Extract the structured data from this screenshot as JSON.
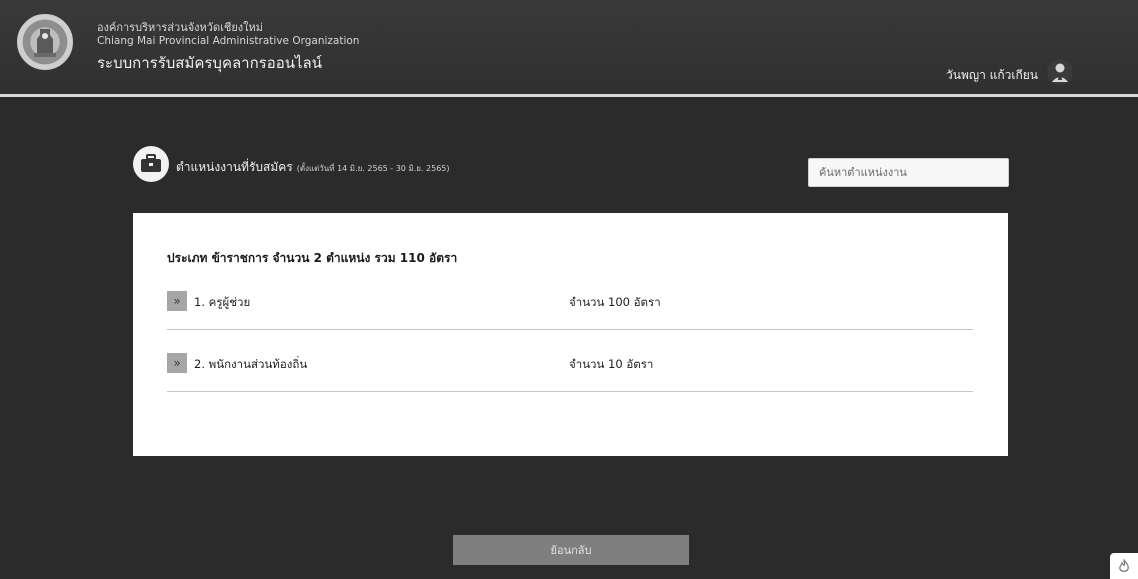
{
  "header": {
    "org_th": "องค์การบริหารส่วนจังหวัดเชียงใหม่",
    "org_en": "Chiang Mai Provincial Administrative Organization",
    "system_title": "ระบบการรับสมัครบุคลากรออนไลน์",
    "user_name": "วันพญา แก้วเกียน",
    "logo_icon": "provincial-seal-logo",
    "avatar_icon": "user-avatar-icon"
  },
  "section": {
    "icon": "briefcase-icon",
    "title": "ตำแหน่งงานที่รับสมัคร",
    "note": "(ตั้งแต่วันที่ 14 มิ.ย. 2565 - 30 มิ.ย. 2565)"
  },
  "search": {
    "placeholder": "ค้นหาตำแหน่งงาน"
  },
  "group": {
    "title": "ประเภท ข้าราชการ จำนวน 2 ตำแหน่ง รวม 110 อัตรา",
    "positions": [
      {
        "name": "1. ครูผู้ช่วย",
        "count": "จำนวน 100 อัตรา"
      },
      {
        "name": "2. พนักงานส่วนท้องถิ่น",
        "count": "จำนวน 10 อัตรา"
      }
    ]
  },
  "back_button": {
    "label": "ย้อนกลับ"
  },
  "colors": {
    "background": "#2b2b2b",
    "card": "#ffffff",
    "button": "#7f7f7f"
  }
}
